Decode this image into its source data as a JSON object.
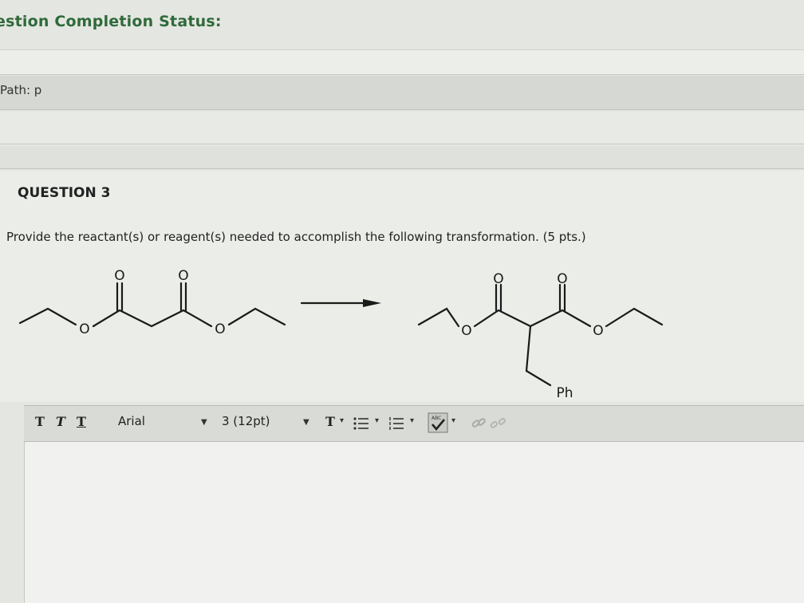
{
  "header": {
    "title": "estion Completion Status:"
  },
  "path": {
    "label": "Path: p"
  },
  "question": {
    "heading": "QUESTION 3",
    "text": "Provide the reactant(s) or reagent(s) needed to accomplish the following transformation. (5 pts.)"
  },
  "scheme": {
    "atom_labels": [
      "O",
      "O",
      "O",
      "O",
      "O",
      "O",
      "O",
      "O"
    ],
    "substituent": "Ph"
  },
  "toolbar": {
    "bold_label": "T",
    "italic_label": "T",
    "underline_label": "T",
    "font_family_value": "Arial",
    "font_size_value": "3 (12pt)",
    "text_color_label": "T",
    "dropdown_arrow": "▼",
    "small_arrow": "▾",
    "spellcheck_label": "ABC"
  },
  "colors": {
    "status_title": "#2f6a3a",
    "toolbar_bg": "#d9dbd6",
    "editor_bg": "#f1f2ef"
  }
}
